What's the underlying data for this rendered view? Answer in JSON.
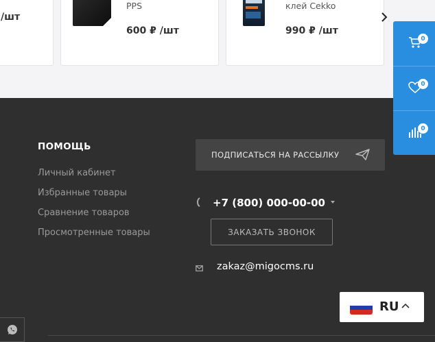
{
  "products": [
    {
      "name": "",
      "price": "/шт"
    },
    {
      "name": "PPS",
      "price": "600 ₽ /шт"
    },
    {
      "name": "клей Cekko",
      "price": "990 ₽ /шт"
    }
  ],
  "footer": {
    "help_title": "ПОМОЩЬ",
    "help_links": [
      "Личный кабинет",
      "Избранные товары",
      "Сравнение товаров",
      "Просмотренные товары"
    ],
    "subscribe_label": "ПОДПИСАТЬСЯ НА РАССЫЛКУ",
    "phone": "+7 (800) 000-00-00",
    "callback_label": "ЗАКАЗАТЬ ЗВОНОК",
    "email": "zakaz@migocms.ru"
  },
  "sidepanel": {
    "cart_count": "0",
    "favorites_count": "0",
    "compare_count": "0"
  },
  "language": {
    "code": "RU"
  },
  "colors": {
    "accent": "#2a8ee0",
    "footer_bg": "#2f2f2f"
  }
}
